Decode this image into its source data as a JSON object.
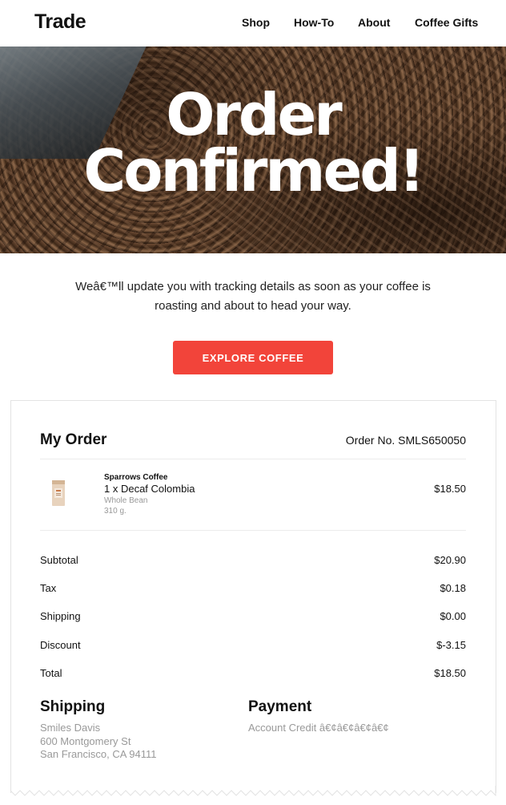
{
  "header": {
    "logo": "Trade",
    "nav": [
      "Shop",
      "How-To",
      "About",
      "Coffee Gifts"
    ]
  },
  "hero": {
    "line1": "Order",
    "line2": "Confirmed!"
  },
  "intro": {
    "text": "Weâ€™ll update you with tracking details as soon as your coffee is roasting and about to head your way."
  },
  "cta": {
    "label": "EXPLORE COFFEE"
  },
  "order": {
    "heading": "My Order",
    "number": "Order No. SMLS650050",
    "item": {
      "brand": "Sparrows Coffee",
      "name": "1 x Decaf Colombia",
      "grind": "Whole Bean",
      "weight": "310 g.",
      "price": "$18.50"
    },
    "summary": [
      {
        "label": "Subtotal",
        "value": "$20.90"
      },
      {
        "label": "Tax",
        "value": "$0.18"
      },
      {
        "label": "Shipping",
        "value": "$0.00"
      },
      {
        "label": "Discount",
        "value": "$-3.15"
      },
      {
        "label": "Total",
        "value": "$18.50"
      }
    ]
  },
  "shipping": {
    "heading": "Shipping",
    "name": "Smiles Davis",
    "street": "600 Montgomery St",
    "city": "San Francisco, CA 94111"
  },
  "payment": {
    "heading": "Payment",
    "method": "Account Credit â€¢â€¢â€¢â€¢"
  },
  "colors": {
    "accent": "#f2443a",
    "muted_text": "#999999"
  }
}
